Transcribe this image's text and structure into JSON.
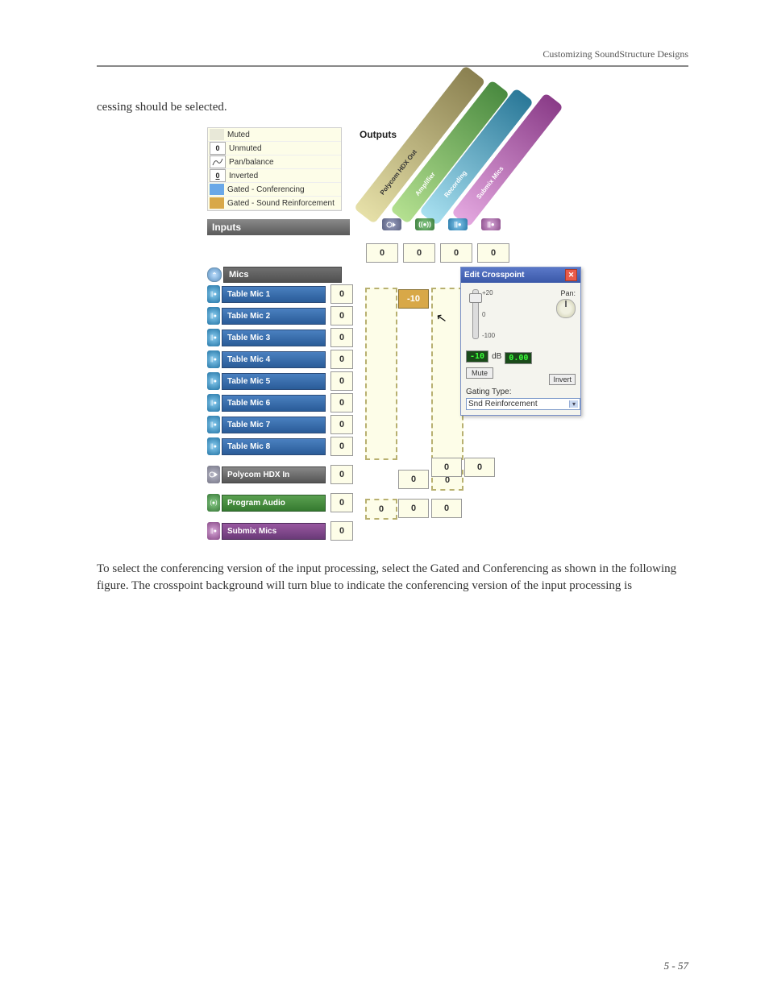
{
  "header": {
    "title": "Customizing SoundStructure Designs"
  },
  "text": {
    "above": "cessing should be selected.",
    "below": "To select the conferencing version of the input processing, select the Gated and Conferencing as shown in the following figure. The crosspoint background will turn blue to indicate the conferencing version of the input processing is"
  },
  "legend": {
    "muted": {
      "label": "Muted"
    },
    "unmuted": {
      "label": "Unmuted",
      "value": "0"
    },
    "pan": {
      "label": "Pan/balance"
    },
    "inverted": {
      "label": "Inverted",
      "value": "0"
    },
    "gconf": {
      "label": "Gated - Conferencing"
    },
    "gsr": {
      "label": "Gated - Sound Reinforcement"
    }
  },
  "outputs": {
    "title": "Outputs",
    "diag": [
      "Polycom HDX Out",
      "Amplifier",
      "Recording",
      "Submix Mics"
    ],
    "base_badges": [
      "",
      "((●))",
      "||●",
      "||●"
    ],
    "col_zero": [
      "0",
      "0",
      "0",
      "0"
    ]
  },
  "inputs": {
    "title": "Inputs",
    "mics_group": "Mics",
    "mics": [
      {
        "label": "Table Mic 1",
        "zero": "0"
      },
      {
        "label": "Table Mic 2",
        "zero": "0"
      },
      {
        "label": "Table Mic 3",
        "zero": "0"
      },
      {
        "label": "Table Mic 4",
        "zero": "0"
      },
      {
        "label": "Table Mic 5",
        "zero": "0"
      },
      {
        "label": "Table Mic 6",
        "zero": "0"
      },
      {
        "label": "Table Mic 7",
        "zero": "0"
      },
      {
        "label": "Table Mic 8",
        "zero": "0"
      }
    ],
    "hdxin": {
      "label": "Polycom HDX In",
      "zero": "0"
    },
    "program": {
      "label": "Program Audio",
      "zero": "0"
    },
    "submix": {
      "label": "Submix Mics",
      "zero": "0"
    }
  },
  "matrix": {
    "val_neg10": "-10",
    "row_hdx": [
      "0",
      "0"
    ],
    "row_hdx_dashed": "0",
    "row_prog": [
      "0",
      "0",
      "0"
    ],
    "row_sub_rec": "0",
    "row_sub_sm": "0"
  },
  "popup": {
    "title": "Edit Crosspoint",
    "slider_top": "+20",
    "slider_mid": "0",
    "slider_bot": "-100",
    "db_val": "-10",
    "db_unit": "dB",
    "mute": "Mute",
    "invert": "Invert",
    "pan_label": "Pan:",
    "pan_val": "0.00",
    "gating_label": "Gating Type:",
    "gating_value": "Snd Reinforcement"
  },
  "page_num": "5 - 57"
}
